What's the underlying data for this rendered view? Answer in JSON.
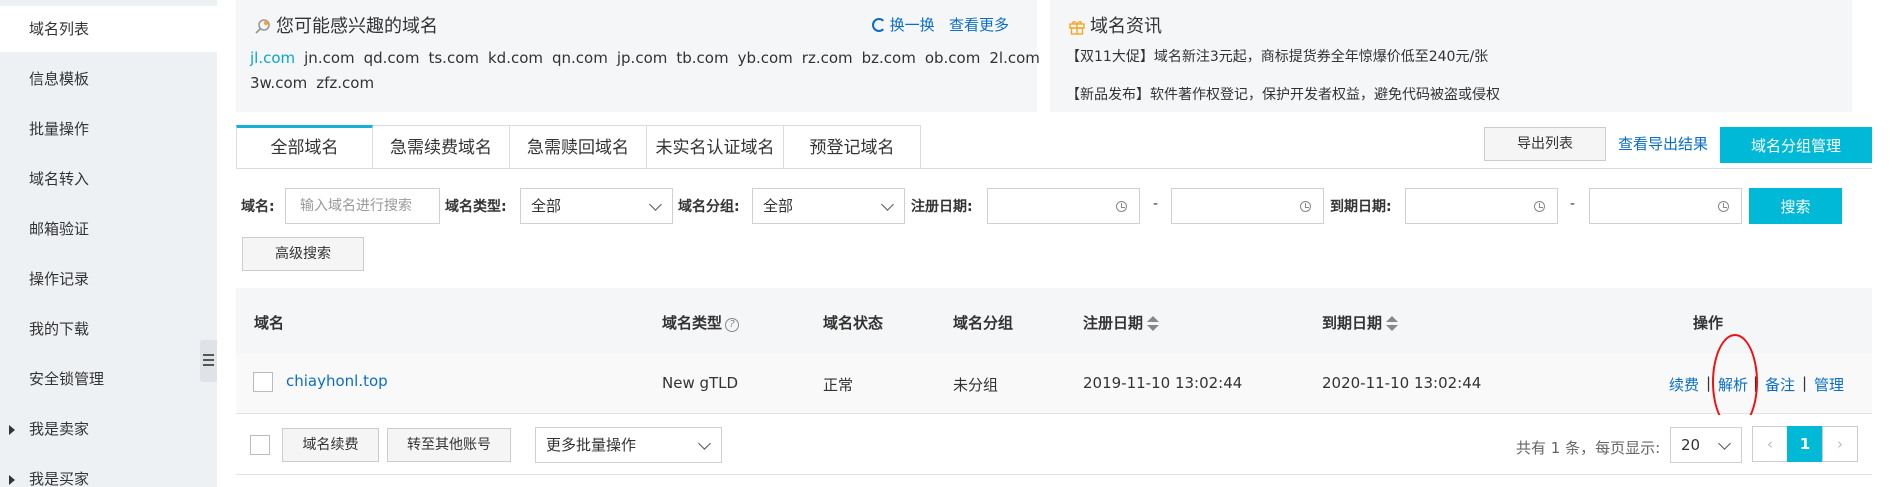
{
  "sidebar": {
    "items": [
      {
        "label": "域名列表"
      },
      {
        "label": "信息模板"
      },
      {
        "label": "批量操作"
      },
      {
        "label": "域名转入"
      },
      {
        "label": "邮箱验证"
      },
      {
        "label": "操作记录"
      },
      {
        "label": "我的下载"
      },
      {
        "label": "安全锁管理"
      },
      {
        "label": "我是卖家"
      },
      {
        "label": "我是买家"
      }
    ]
  },
  "suggest": {
    "title": "您可能感兴趣的域名",
    "refresh_label": "换一换",
    "more_label": "查看更多",
    "domains": [
      "jl.com",
      "jn.com",
      "qd.com",
      "ts.com",
      "kd.com",
      "qn.com",
      "jp.com",
      "tb.com",
      "yb.com",
      "rz.com",
      "bz.com",
      "ob.com",
      "2l.com",
      "3w.com",
      "zfz.com"
    ]
  },
  "news": {
    "title": "域名资讯",
    "items": [
      "【双11大促】域名新注3元起，商标提货券全年惊爆价低至240元/张",
      "【新品发布】软件著作权登记，保护开发者权益，避免代码被盗或侵权"
    ]
  },
  "tabs": [
    {
      "label": "全部域名"
    },
    {
      "label": "急需续费域名"
    },
    {
      "label": "急需赎回域名"
    },
    {
      "label": "未实名认证域名"
    },
    {
      "label": "预登记域名"
    }
  ],
  "toolbar": {
    "export_label": "导出列表",
    "view_export_label": "查看导出结果",
    "group_manage_label": "域名分组管理"
  },
  "filters": {
    "domain_label": "域名:",
    "domain_placeholder": "输入域名进行搜索",
    "type_label": "域名类型:",
    "type_value": "全部",
    "group_label": "域名分组:",
    "group_value": "全部",
    "reg_date_label": "注册日期:",
    "exp_date_label": "到期日期:",
    "range_sep": "-",
    "search_label": "搜索",
    "advanced_label": "高级搜索"
  },
  "table": {
    "headers": {
      "domain": "域名",
      "type": "域名类型",
      "status": "域名状态",
      "group": "域名分组",
      "reg_date": "注册日期",
      "exp_date": "到期日期",
      "actions": "操作"
    },
    "rows": [
      {
        "domain": "chiayhonl.top",
        "type": "New gTLD",
        "status": "正常",
        "group": "未分组",
        "reg_date": "2019-11-10 13:02:44",
        "exp_date": "2020-11-10 13:02:44",
        "actions": [
          "续费",
          "解析",
          "备注",
          "管理"
        ]
      }
    ],
    "action_sep": "|"
  },
  "footer": {
    "renew_label": "域名续费",
    "transfer_label": "转至其他账号",
    "batch_select_value": "更多批量操作",
    "total_text": "共有 1 条，每页显示:",
    "page_size_value": "20",
    "prev_label": "‹",
    "next_label": "›",
    "current_page": "1"
  },
  "colors": {
    "accent": "#00b9d7",
    "link": "#0a6ec6",
    "highlight_ring": "#e11111"
  }
}
